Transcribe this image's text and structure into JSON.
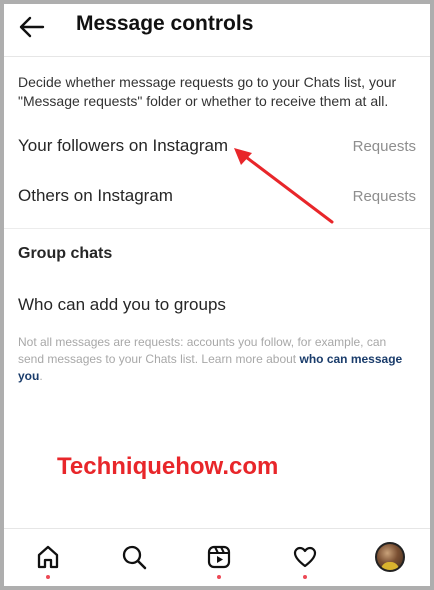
{
  "header": {
    "title": "Message controls"
  },
  "description": "Decide whether message requests go to your Chats list, your \"Message requests\" folder or whether to receive them at all.",
  "rows": [
    {
      "label": "Your followers on Instagram",
      "value": "Requests"
    },
    {
      "label": "Others on Instagram",
      "value": "Requests"
    }
  ],
  "group_chats": {
    "section_title": "Group chats",
    "row_label": "Who can add you to groups"
  },
  "note": {
    "text": "Not all messages are requests: accounts you follow, for example, can send messages to your Chats list. Learn more about ",
    "link": "who can message you",
    "end": "."
  },
  "watermark": "Techniquehow.com",
  "nav": {
    "items": [
      "home-icon",
      "search-icon",
      "reels-icon",
      "heart-icon",
      "profile-avatar"
    ]
  },
  "colors": {
    "accent_red": "#e8262a",
    "link_blue": "#1a3c6b",
    "notification_dot": "#ed4956"
  }
}
